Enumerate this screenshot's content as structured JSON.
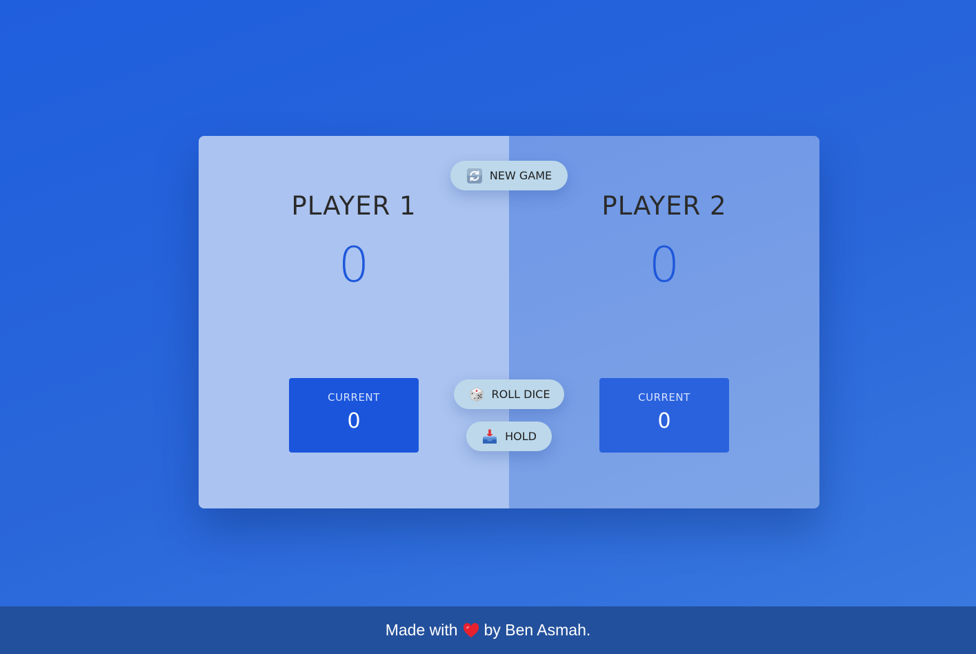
{
  "players": [
    {
      "name": "PLAYER 1",
      "score": "0",
      "current_label": "CURRENT",
      "current_score": "0"
    },
    {
      "name": "PLAYER 2",
      "score": "0",
      "current_label": "CURRENT",
      "current_score": "0"
    }
  ],
  "buttons": {
    "new_game": {
      "label": "NEW GAME",
      "icon": "refresh-icon"
    },
    "roll_dice": {
      "label": "ROLL DICE",
      "icon": "dice-icon"
    },
    "hold": {
      "label": "HOLD",
      "icon": "inbox-tray-icon"
    }
  },
  "footer": {
    "prefix": "Made with",
    "icon": "heart-icon",
    "suffix": "by Ben Asmah."
  },
  "colors": {
    "background": "#2462db",
    "player_active_panel": "#abc3f0",
    "player_inactive_panel": "#77a0e6",
    "score_blue": "#1d57db",
    "current_box": "#1a55dc",
    "button_bg": "#bdd8ea",
    "footer_bg": "#23509c",
    "heart": "#e8212f"
  }
}
